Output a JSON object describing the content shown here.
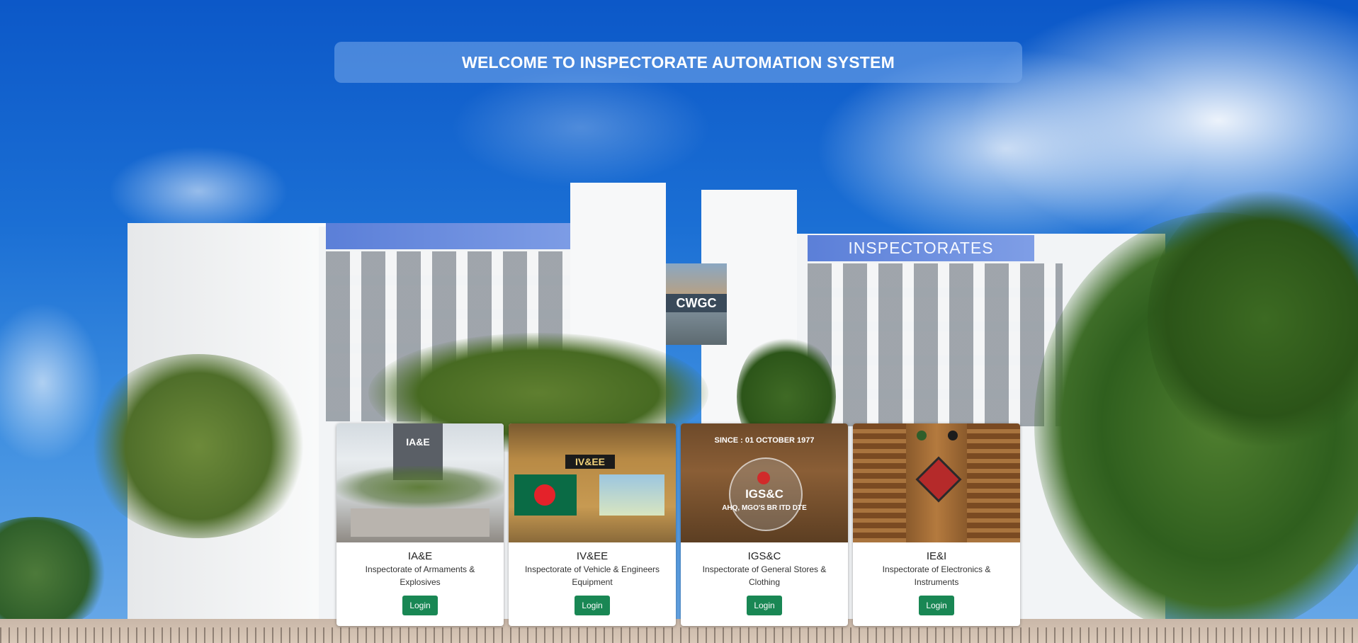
{
  "header": {
    "title": "WELCOME TO INSPECTORATE AUTOMATION SYSTEM"
  },
  "background": {
    "banner_text": "INSPECTORATES",
    "sign_text": "CWGC"
  },
  "cards": [
    {
      "image_text": "IA&E",
      "title": "IA&E",
      "description": "Inspectorate of Armaments & Explosives",
      "button": "Login"
    },
    {
      "image_text": "IV&EE",
      "title": "IV&EE",
      "description": "Inspectorate of Vehicle & Engineers Equipment",
      "button": "Login"
    },
    {
      "image_text": "IGS&C",
      "image_caption_top": "SINCE : 01 OCTOBER 1977",
      "image_caption_bottom": "AHQ, MGO'S BR ITD DTE",
      "title": "IGS&C",
      "description": "Inspectorate of General Stores & Clothing",
      "button": "Login"
    },
    {
      "title": "IE&I",
      "description": "Inspectorate of Electronics & Instruments",
      "button": "Login"
    }
  ],
  "colors": {
    "button": "#198754",
    "sky": "#1b6fd4"
  }
}
